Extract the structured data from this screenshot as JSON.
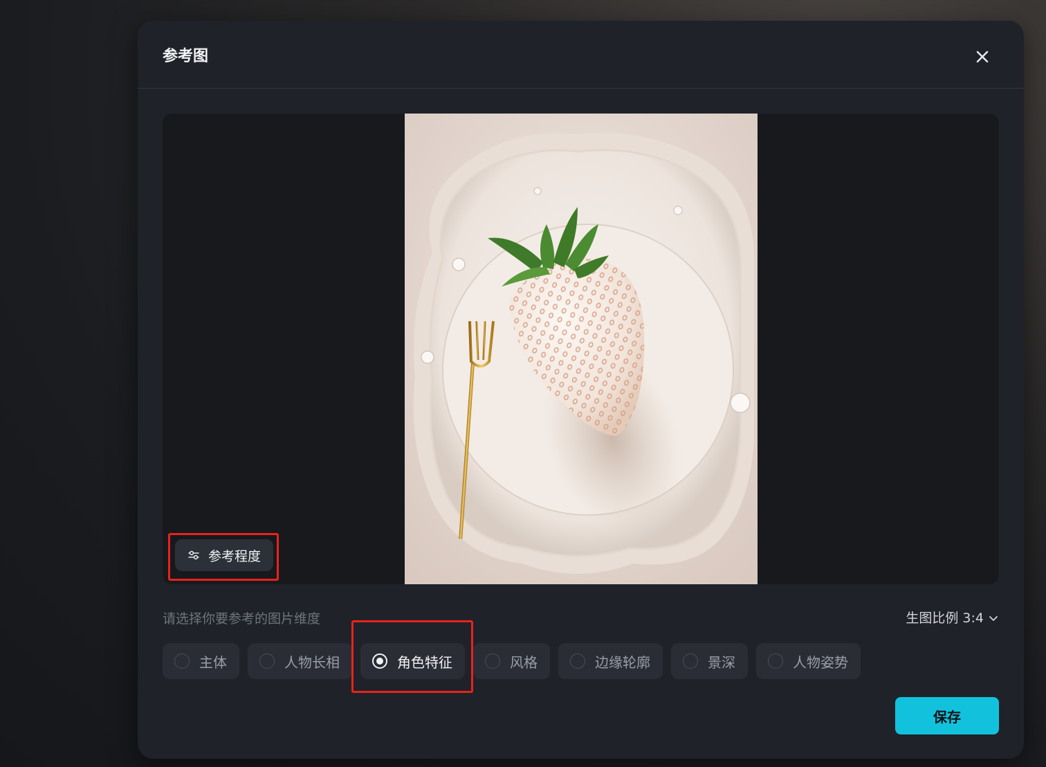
{
  "dialog": {
    "title": "参考图"
  },
  "preview": {
    "ref_degree_label": "参考程度"
  },
  "dimension": {
    "hint": "请选择你要参考的图片维度",
    "ratio_label": "生图比例 3:4",
    "options": [
      {
        "label": "主体",
        "selected": false
      },
      {
        "label": "人物长相",
        "selected": false
      },
      {
        "label": "角色特征",
        "selected": true
      },
      {
        "label": "风格",
        "selected": false
      },
      {
        "label": "边缘轮廓",
        "selected": false
      },
      {
        "label": "景深",
        "selected": false
      },
      {
        "label": "人物姿势",
        "selected": false
      }
    ]
  },
  "footer": {
    "save_label": "保存"
  },
  "colors": {
    "accent": "#12c2dd",
    "highlight": "#e8231c",
    "modal_bg": "#1f2229"
  }
}
